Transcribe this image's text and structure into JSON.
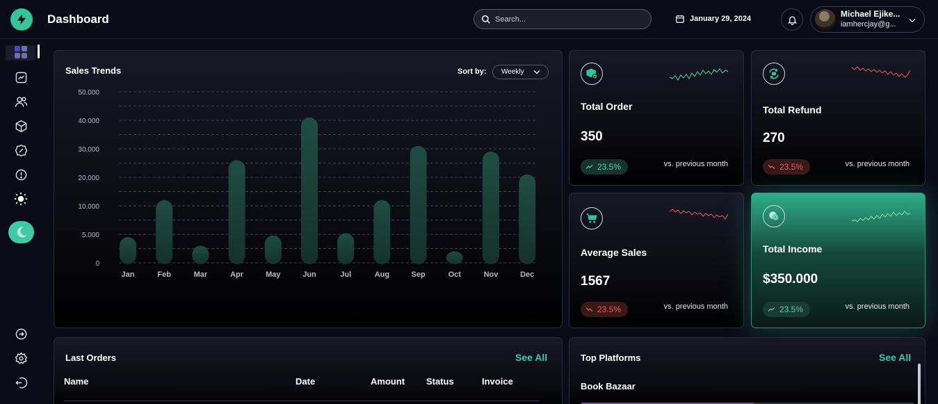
{
  "header": {
    "title": "Dashboard",
    "search_placeholder": "Search...",
    "date": "January 29, 2024",
    "user_name": "Michael Ejike...",
    "user_email": "iamhercjay@g..."
  },
  "sales_trends": {
    "title": "Sales Trends",
    "sort_label": "Sort by:",
    "sort_value": "Weekly"
  },
  "chart_data": {
    "type": "bar",
    "categories": [
      "Jan",
      "Feb",
      "Mar",
      "Apr",
      "May",
      "Jun",
      "Jul",
      "Aug",
      "Sep",
      "Oct",
      "Nov",
      "Dec"
    ],
    "values": [
      4500,
      12000,
      3000,
      26000,
      4800,
      41000,
      5200,
      12000,
      31000,
      2000,
      29000,
      21000
    ],
    "yticks": [
      0,
      5000,
      10000,
      20000,
      30000,
      40000,
      50000
    ],
    "ytick_labels": [
      "0",
      "5.000",
      "10.000",
      "20.000",
      "30.000",
      "40.000",
      "50.000"
    ],
    "ylim": [
      0,
      50000
    ],
    "grid": true,
    "bar_color": "#1f4d43"
  },
  "stats": {
    "total_order": {
      "title": "Total Order",
      "value": "350",
      "change": "23.5%",
      "trend": "up",
      "vs": "vs. previous month"
    },
    "total_refund": {
      "title": "Total Refund",
      "value": "270",
      "change": "23.5%",
      "trend": "down",
      "vs": "vs. previous month"
    },
    "average_sales": {
      "title": "Average Sales",
      "value": "1567",
      "change": "23.5%",
      "trend": "down",
      "vs": "vs. previous month"
    },
    "total_income": {
      "title": "Total Income",
      "value": "$350.000",
      "change": "23.5%",
      "trend": "up",
      "vs": "vs. previous month"
    }
  },
  "last_orders": {
    "title": "Last Orders",
    "see_all": "See All",
    "columns": [
      "Name",
      "Date",
      "Amount",
      "Status",
      "Invoice"
    ]
  },
  "top_platforms": {
    "title": "Top Platforms",
    "see_all": "See All",
    "items": [
      {
        "name": "Book Bazaar",
        "share": 0.52
      }
    ]
  },
  "colors": {
    "accent": "#3fc9a5",
    "up": "#4fd6a8",
    "down": "#f05a5a",
    "platform_bar": "#9b2fd6"
  }
}
